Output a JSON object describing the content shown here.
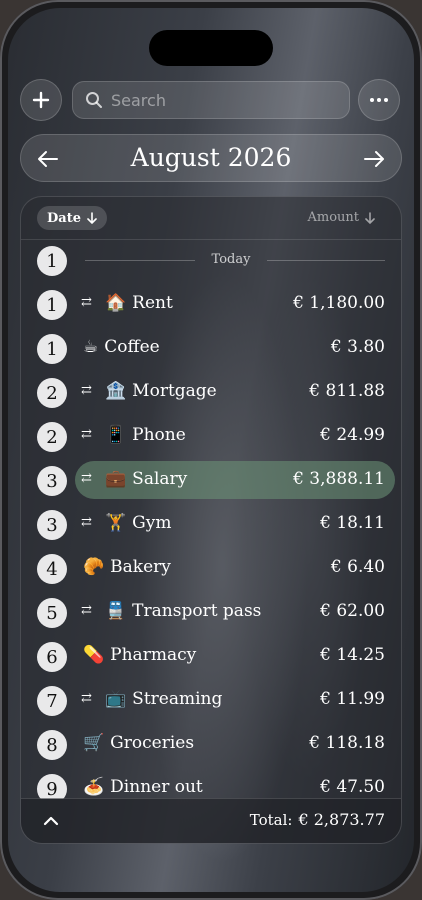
{
  "search": {
    "placeholder": "Search"
  },
  "month": {
    "title": "August 2026"
  },
  "sort": {
    "date_label": "Date",
    "amount_label": "Amount"
  },
  "today": {
    "day": "1",
    "label": "Today"
  },
  "transactions": [
    {
      "day": "1",
      "recurring": true,
      "icon": "house-icon",
      "emoji": "🏠",
      "name": "Rent",
      "amount": "€ 1,180.00"
    },
    {
      "day": "1",
      "recurring": false,
      "icon": "coffee-icon",
      "emoji": "☕",
      "name": "Coffee",
      "amount": "€ 3.80"
    },
    {
      "day": "2",
      "recurring": true,
      "icon": "bank-icon",
      "emoji": "🏦",
      "name": "Mortgage",
      "amount": "€ 811.88"
    },
    {
      "day": "2",
      "recurring": true,
      "icon": "phone-icon",
      "emoji": "📱",
      "name": "Phone",
      "amount": "€ 24.99"
    },
    {
      "day": "3",
      "recurring": true,
      "icon": "briefcase-icon",
      "emoji": "💼",
      "name": "Salary",
      "amount": "€ 3,888.11",
      "highlight": true
    },
    {
      "day": "3",
      "recurring": true,
      "icon": "weightlifter-icon",
      "emoji": "🏋",
      "name": "Gym",
      "amount": "€ 18.11"
    },
    {
      "day": "4",
      "recurring": false,
      "icon": "croissant-icon",
      "emoji": "🥐",
      "name": "Bakery",
      "amount": "€ 6.40"
    },
    {
      "day": "5",
      "recurring": true,
      "icon": "train-icon",
      "emoji": "🚆",
      "name": "Transport pass",
      "amount": "€ 62.00"
    },
    {
      "day": "6",
      "recurring": false,
      "icon": "pill-icon",
      "emoji": "💊",
      "name": "Pharmacy",
      "amount": "€ 14.25"
    },
    {
      "day": "7",
      "recurring": true,
      "icon": "tv-icon",
      "emoji": "📺",
      "name": "Streaming",
      "amount": "€ 11.99"
    },
    {
      "day": "8",
      "recurring": false,
      "icon": "cart-icon",
      "emoji": "🛒",
      "name": "Groceries",
      "amount": "€ 118.18"
    },
    {
      "day": "9",
      "recurring": false,
      "icon": "spaghetti-icon",
      "emoji": "🍝",
      "name": "Dinner out",
      "amount": "€ 47.50"
    }
  ],
  "footer": {
    "total_label": "Total:",
    "total_value": "€ 2,873.77"
  },
  "colors": {
    "highlight": "#5f7f68",
    "day_badge": "#e9e9ea"
  }
}
